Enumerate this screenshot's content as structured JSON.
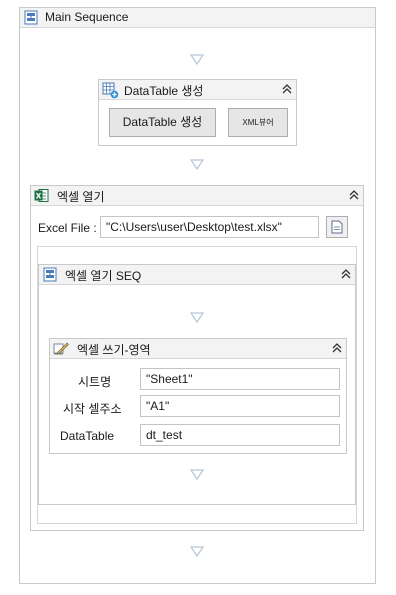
{
  "main_sequence": {
    "title": "Main Sequence"
  },
  "datatable_create": {
    "title": "DataTable 생성",
    "create_button": "DataTable 생성",
    "xml_button": "XML뷰어"
  },
  "excel_open": {
    "title": "엑셀 열기",
    "file_label": "Excel File :",
    "file_value": "\"C:\\Users\\user\\Desktop\\test.xlsx\"",
    "seq": {
      "title": "엑셀 열기 SEQ",
      "write_range": {
        "title": "엑셀 쓰기-영역",
        "fields": [
          {
            "label": "시트명",
            "value": "\"Sheet1\""
          },
          {
            "label": "시작 셀주소",
            "value": "\"A1\""
          },
          {
            "label": "DataTable",
            "value": "dt_test"
          }
        ]
      }
    }
  },
  "colors": {
    "border": "#c9c9c9",
    "header_bg": "#f3f3f3",
    "connector": "#b8c8d8",
    "button_bg": "#e6e6e6",
    "excel_green": "#1e7145",
    "icon_blue": "#4a7ab8"
  },
  "icons": [
    "sequence-icon",
    "datatable-icon",
    "excel-icon",
    "collapse-icon",
    "connector-arrow",
    "edit-icon",
    "file-browse-icon"
  ]
}
